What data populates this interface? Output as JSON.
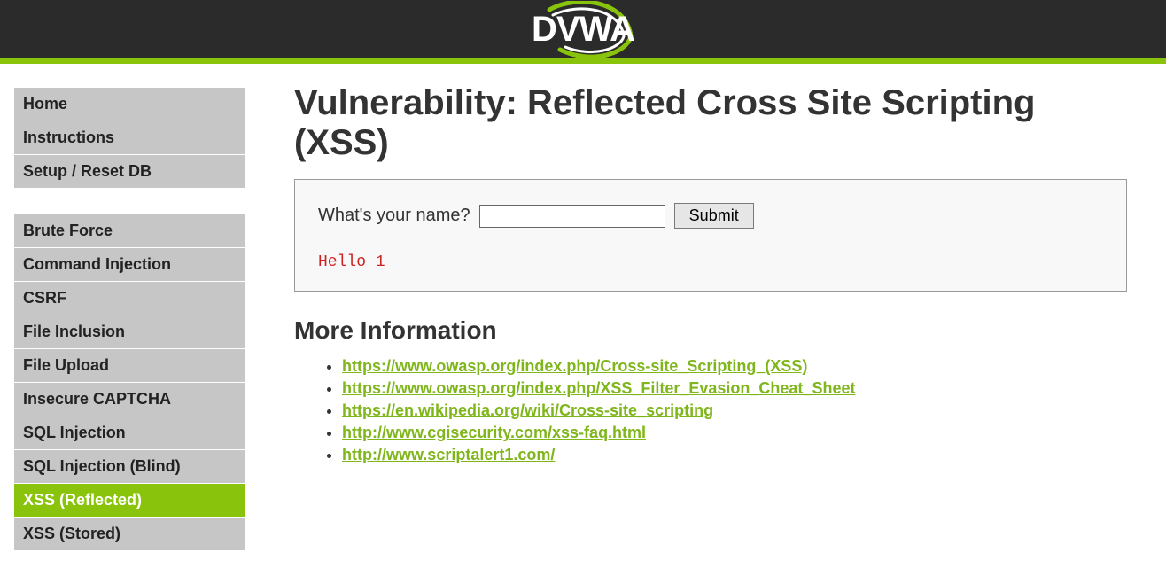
{
  "logo": {
    "text": "DVWA"
  },
  "sidebar": {
    "groups": [
      {
        "items": [
          {
            "label": "Home",
            "name": "home"
          },
          {
            "label": "Instructions",
            "name": "instructions"
          },
          {
            "label": "Setup / Reset DB",
            "name": "setup-reset-db"
          }
        ]
      },
      {
        "items": [
          {
            "label": "Brute Force",
            "name": "brute-force"
          },
          {
            "label": "Command Injection",
            "name": "command-injection"
          },
          {
            "label": "CSRF",
            "name": "csrf"
          },
          {
            "label": "File Inclusion",
            "name": "file-inclusion"
          },
          {
            "label": "File Upload",
            "name": "file-upload"
          },
          {
            "label": "Insecure CAPTCHA",
            "name": "insecure-captcha"
          },
          {
            "label": "SQL Injection",
            "name": "sql-injection"
          },
          {
            "label": "SQL Injection (Blind)",
            "name": "sql-injection-blind"
          },
          {
            "label": "XSS (Reflected)",
            "name": "xss-reflected",
            "selected": true
          },
          {
            "label": "XSS (Stored)",
            "name": "xss-stored"
          }
        ]
      }
    ]
  },
  "main": {
    "title": "Vulnerability: Reflected Cross Site Scripting (XSS)",
    "form": {
      "label": "What's your name?",
      "value": "",
      "submit_label": "Submit"
    },
    "result": "Hello 1",
    "more_info_title": "More Information",
    "links": [
      "https://www.owasp.org/index.php/Cross-site_Scripting_(XSS)",
      "https://www.owasp.org/index.php/XSS_Filter_Evasion_Cheat_Sheet",
      "https://en.wikipedia.org/wiki/Cross-site_scripting",
      "http://www.cgisecurity.com/xss-faq.html",
      "http://www.scriptalert1.com/"
    ]
  }
}
